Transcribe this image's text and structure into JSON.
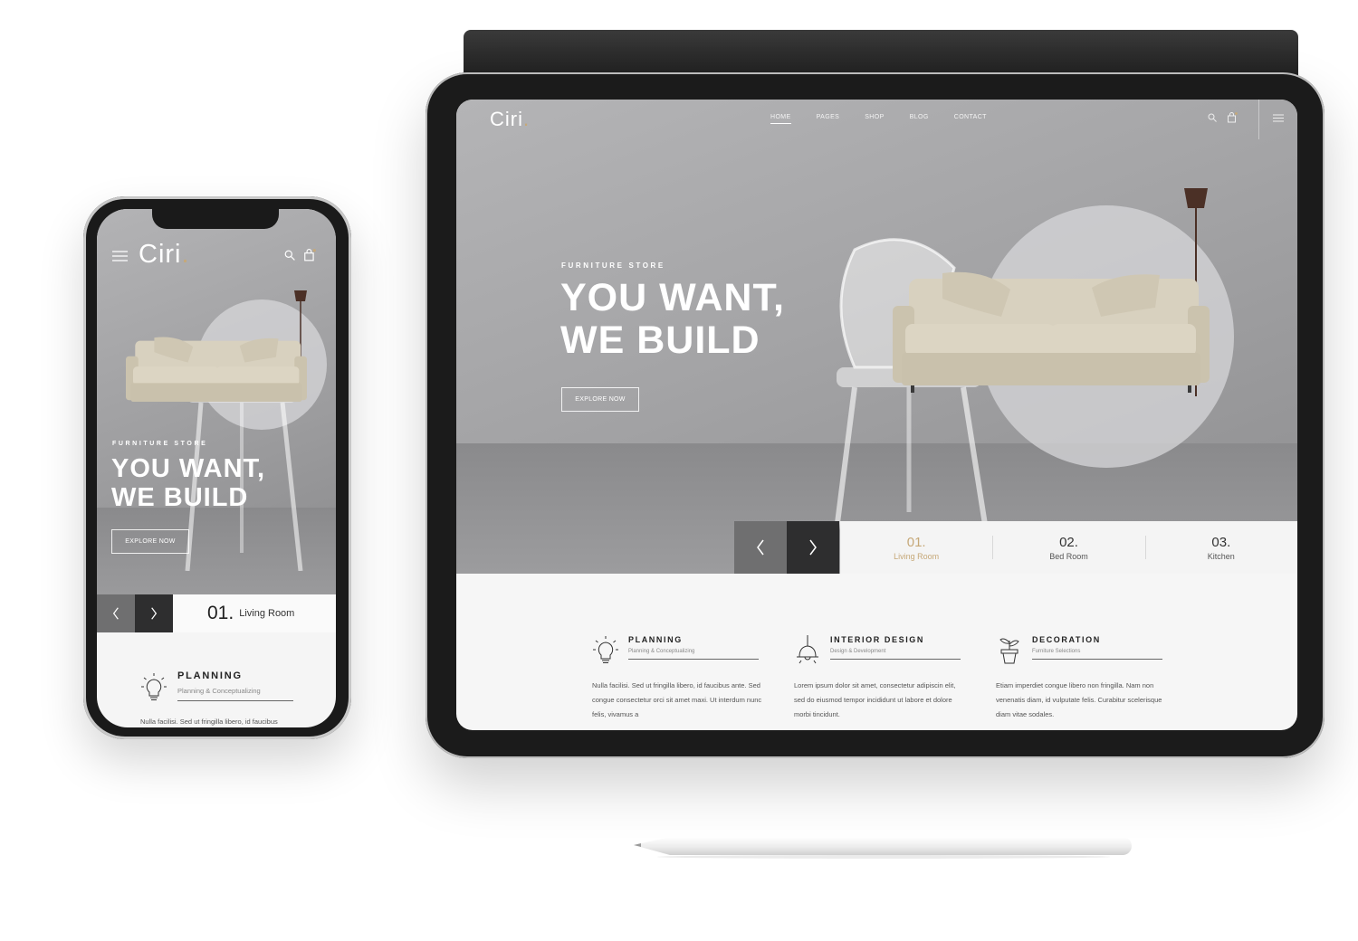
{
  "brand": {
    "name": "Ciri",
    "dot": ".",
    "accent": "#c6a878"
  },
  "nav": {
    "items": [
      "HOME",
      "PAGES",
      "SHOP",
      "BLOG",
      "CONTACT"
    ],
    "active": "HOME"
  },
  "hero": {
    "eyebrow": "FURNITURE STORE",
    "line1": "YOU WANT,",
    "line2": "WE BUILD",
    "cta": "EXPLORE NOW"
  },
  "slides": [
    {
      "num": "01.",
      "label": "Living Room"
    },
    {
      "num": "02.",
      "label": "Bed Room"
    },
    {
      "num": "03.",
      "label": "Kitchen"
    }
  ],
  "features": [
    {
      "icon": "lightbulb-icon",
      "title": "PLANNING",
      "subtitle": "Planning & Conceptualizing",
      "text": "Nulla facilisi. Sed ut fringilla libero, id faucibus ante. Sed congue consectetur orci sit amet maxi. Ut interdum nunc felis, vivamus a"
    },
    {
      "icon": "pendant-lamp-icon",
      "title": "INTERIOR DESIGN",
      "subtitle": "Design & Development",
      "text": "Lorem ipsum dolor sit amet, consectetur adipiscin elit, sed do eiusmod tempor incididunt ut labore et dolore morbi tincidunt."
    },
    {
      "icon": "plant-pot-icon",
      "title": "DECORATION",
      "subtitle": "Furniture Selections",
      "text": "Etiam imperdiet congue libero non fringilla. Nam non venenatis diam, id vulputate felis. Curabitur scelerisque diam vitae sodales."
    }
  ],
  "phone": {
    "feature_text_snippet": "Nulla facilisi. Sed ut fringilla libero, id faucibus"
  }
}
